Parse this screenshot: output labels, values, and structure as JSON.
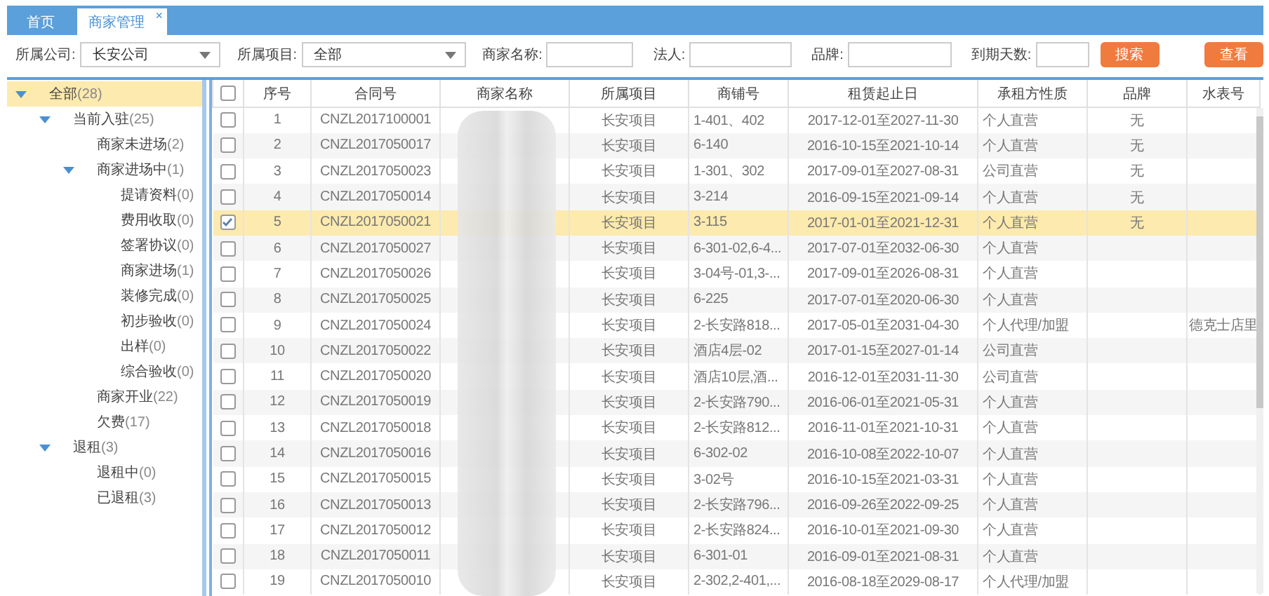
{
  "tabs": [
    {
      "label": "首页",
      "selected": false
    },
    {
      "label": "商家管理",
      "selected": true,
      "close": "×"
    }
  ],
  "filters": [
    {
      "kind": "select",
      "label": "所属公司:",
      "value": "长安公司"
    },
    {
      "kind": "select",
      "label": "所属项目:",
      "value": "全部"
    },
    {
      "kind": "input",
      "label": "商家名称:"
    },
    {
      "kind": "input",
      "label": "法人:"
    },
    {
      "kind": "input",
      "label": "品牌:"
    },
    {
      "kind": "input",
      "label": "到期天数:"
    }
  ],
  "search_button": "搜索",
  "view_button": "查看",
  "tree": [
    {
      "label": "全部",
      "count": "(28)",
      "expanded": true,
      "selected": true,
      "children": [
        {
          "label": "当前入驻",
          "count": "(25)",
          "expanded": true,
          "selected": false,
          "children": [
            {
              "label": "商家未进场",
              "count": "(2)",
              "selected": false
            },
            {
              "label": "商家进场中",
              "count": "(1)",
              "expanded": true,
              "selected": false,
              "children": [
                {
                  "label": "提请资料",
                  "count": "(0)",
                  "selected": false
                },
                {
                  "label": "费用收取",
                  "count": "(0)",
                  "selected": false
                },
                {
                  "label": "签署协议",
                  "count": "(0)",
                  "selected": false
                },
                {
                  "label": "商家进场",
                  "count": "(1)",
                  "selected": false
                },
                {
                  "label": "装修完成",
                  "count": "(0)",
                  "selected": false
                },
                {
                  "label": "初步验收",
                  "count": "(0)",
                  "selected": false
                },
                {
                  "label": "出样",
                  "count": "(0)",
                  "selected": false
                },
                {
                  "label": "综合验收",
                  "count": "(0)",
                  "selected": false
                }
              ]
            },
            {
              "label": "商家开业",
              "count": "(22)",
              "selected": false
            },
            {
              "label": "欠费",
              "count": "(17)",
              "selected": false
            }
          ]
        },
        {
          "label": "退租",
          "count": "(3)",
          "expanded": true,
          "selected": false,
          "children": [
            {
              "label": "退租中",
              "count": "(0)",
              "selected": false
            },
            {
              "label": "已退租",
              "count": "(3)",
              "selected": false
            }
          ]
        }
      ]
    }
  ],
  "table": {
    "all_checked": false,
    "columns": [
      "序号",
      "合同号",
      "商家名称",
      "所属项目",
      "商铺号",
      "租赁起止日",
      "承租方性质",
      "品牌",
      "水表号"
    ],
    "rows": [
      {
        "no": "1",
        "contract": "CNZL2017100001",
        "project": "长安项目",
        "shop": "1-401、402",
        "term": "2017-12-01至2027-11-30",
        "tenant": "个人直营",
        "brand": "无",
        "meter": "",
        "selected": false
      },
      {
        "no": "2",
        "contract": "CNZL2017050017",
        "project": "长安项目",
        "shop": "6-140",
        "term": "2016-10-15至2021-10-14",
        "tenant": "个人直营",
        "brand": "无",
        "meter": "",
        "selected": false
      },
      {
        "no": "3",
        "contract": "CNZL2017050023",
        "project": "长安项目",
        "shop": "1-301、302",
        "term": "2017-09-01至2027-08-31",
        "tenant": "公司直营",
        "brand": "无",
        "meter": "",
        "selected": false
      },
      {
        "no": "4",
        "contract": "CNZL2017050014",
        "project": "长安项目",
        "shop": "3-214",
        "term": "2016-09-15至2021-09-14",
        "tenant": "个人直营",
        "brand": "无",
        "meter": "",
        "selected": false
      },
      {
        "no": "5",
        "contract": "CNZL2017050021",
        "project": "长安项目",
        "shop": "3-115",
        "term": "2017-01-01至2021-12-31",
        "tenant": "个人直营",
        "brand": "无",
        "meter": "",
        "selected": true
      },
      {
        "no": "6",
        "contract": "CNZL2017050027",
        "project": "长安项目",
        "shop": "6-301-02,6-4...",
        "term": "2017-07-01至2032-06-30",
        "tenant": "个人直营",
        "brand": "",
        "meter": "",
        "selected": false
      },
      {
        "no": "7",
        "contract": "CNZL2017050026",
        "project": "长安项目",
        "shop": "3-04号-01,3-...",
        "term": "2017-09-01至2026-08-31",
        "tenant": "个人直营",
        "brand": "",
        "meter": "",
        "selected": false
      },
      {
        "no": "8",
        "contract": "CNZL2017050025",
        "project": "长安项目",
        "shop": "6-225",
        "term": "2017-07-01至2020-06-30",
        "tenant": "个人直营",
        "brand": "",
        "meter": "",
        "selected": false
      },
      {
        "no": "9",
        "contract": "CNZL2017050024",
        "project": "长安项目",
        "shop": "2-长安路818...",
        "term": "2017-05-01至2031-04-30",
        "tenant": "个人代理/加盟",
        "brand": "",
        "meter": "德克士店里",
        "selected": false
      },
      {
        "no": "10",
        "contract": "CNZL2017050022",
        "project": "长安项目",
        "shop": "酒店4层-02",
        "term": "2017-01-15至2027-01-14",
        "tenant": "公司直营",
        "brand": "",
        "meter": "",
        "selected": false
      },
      {
        "no": "11",
        "contract": "CNZL2017050020",
        "project": "长安项目",
        "shop": "酒店10层,酒...",
        "term": "2016-12-01至2031-11-30",
        "tenant": "公司直营",
        "brand": "",
        "meter": "",
        "selected": false
      },
      {
        "no": "12",
        "contract": "CNZL2017050019",
        "project": "长安项目",
        "shop": "2-长安路790...",
        "term": "2016-06-01至2021-05-31",
        "tenant": "个人直营",
        "brand": "",
        "meter": "",
        "selected": false
      },
      {
        "no": "13",
        "contract": "CNZL2017050018",
        "project": "长安项目",
        "shop": "2-长安路812...",
        "term": "2016-11-01至2021-10-31",
        "tenant": "个人直营",
        "brand": "",
        "meter": "",
        "selected": false
      },
      {
        "no": "14",
        "contract": "CNZL2017050016",
        "project": "长安项目",
        "shop": "6-302-02",
        "term": "2016-10-08至2022-10-07",
        "tenant": "个人直营",
        "brand": "",
        "meter": "",
        "selected": false
      },
      {
        "no": "15",
        "contract": "CNZL2017050015",
        "project": "长安项目",
        "shop": "3-02号",
        "term": "2016-10-15至2021-03-31",
        "tenant": "个人直营",
        "brand": "",
        "meter": "",
        "selected": false
      },
      {
        "no": "16",
        "contract": "CNZL2017050013",
        "project": "长安项目",
        "shop": "2-长安路796...",
        "term": "2016-09-26至2022-09-25",
        "tenant": "个人直营",
        "brand": "",
        "meter": "",
        "selected": false
      },
      {
        "no": "17",
        "contract": "CNZL2017050012",
        "project": "长安项目",
        "shop": "2-长安路824...",
        "term": "2016-10-01至2021-09-30",
        "tenant": "个人直营",
        "brand": "",
        "meter": "",
        "selected": false
      },
      {
        "no": "18",
        "contract": "CNZL2017050011",
        "project": "长安项目",
        "shop": "6-301-01",
        "term": "2016-09-01至2021-08-31",
        "tenant": "个人直营",
        "brand": "",
        "meter": "",
        "selected": false
      },
      {
        "no": "19",
        "contract": "CNZL2017050010",
        "project": "长安项目",
        "shop": "2-302,2-401,...",
        "term": "2016-08-18至2029-08-17",
        "tenant": "个人代理/加盟",
        "brand": "",
        "meter": "",
        "selected": false
      }
    ]
  }
}
